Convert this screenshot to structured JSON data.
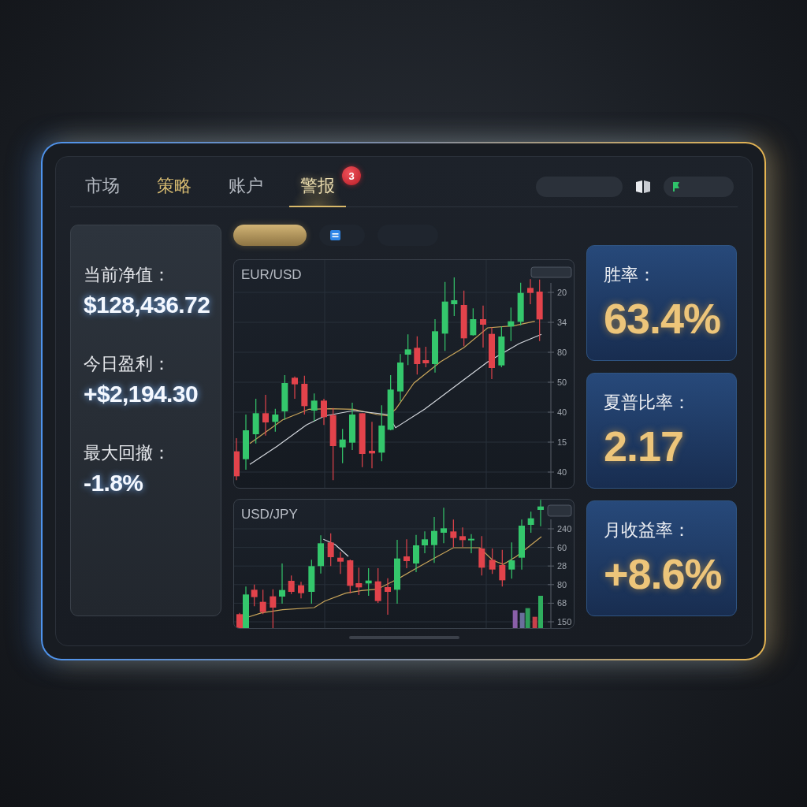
{
  "tabs": [
    {
      "label": "市场",
      "selected": false,
      "color": "#b4b9c1"
    },
    {
      "label": "策略",
      "selected": false,
      "color": "#d9bd72"
    },
    {
      "label": "账户",
      "selected": false,
      "color": "#b4b9c1"
    },
    {
      "label": "警报",
      "selected": true,
      "color": "#eadcae",
      "badge": "3"
    }
  ],
  "toolbar": [
    {
      "kind": "pill"
    },
    {
      "kind": "book"
    },
    {
      "kind": "pill_flag"
    }
  ],
  "account_summary": [
    {
      "label": "当前净值：",
      "value": "$128,436.72"
    },
    {
      "label": "今日盈利：",
      "value": "+$2,194.30"
    },
    {
      "label": "最大回撤：",
      "value": "-1.8%"
    }
  ],
  "filter_chips": [
    {
      "kind": "plain",
      "selected": true
    },
    {
      "kind": "icon",
      "selected": false
    },
    {
      "kind": "plain",
      "selected": false
    }
  ],
  "charts": [
    {
      "symbol": "EUR/USD",
      "axis_labels": [
        "20",
        "34",
        "80",
        "50",
        "40",
        "15",
        "40"
      ]
    },
    {
      "symbol": "USD/JPY",
      "axis_labels": [
        "240",
        "60",
        "28",
        "80",
        "68",
        "150"
      ]
    }
  ],
  "metrics": [
    {
      "label": "胜率：",
      "value": "63.4%"
    },
    {
      "label": "夏普比率：",
      "value": "2.17"
    },
    {
      "label": "月收益率：",
      "value": "+8.6%"
    }
  ]
}
